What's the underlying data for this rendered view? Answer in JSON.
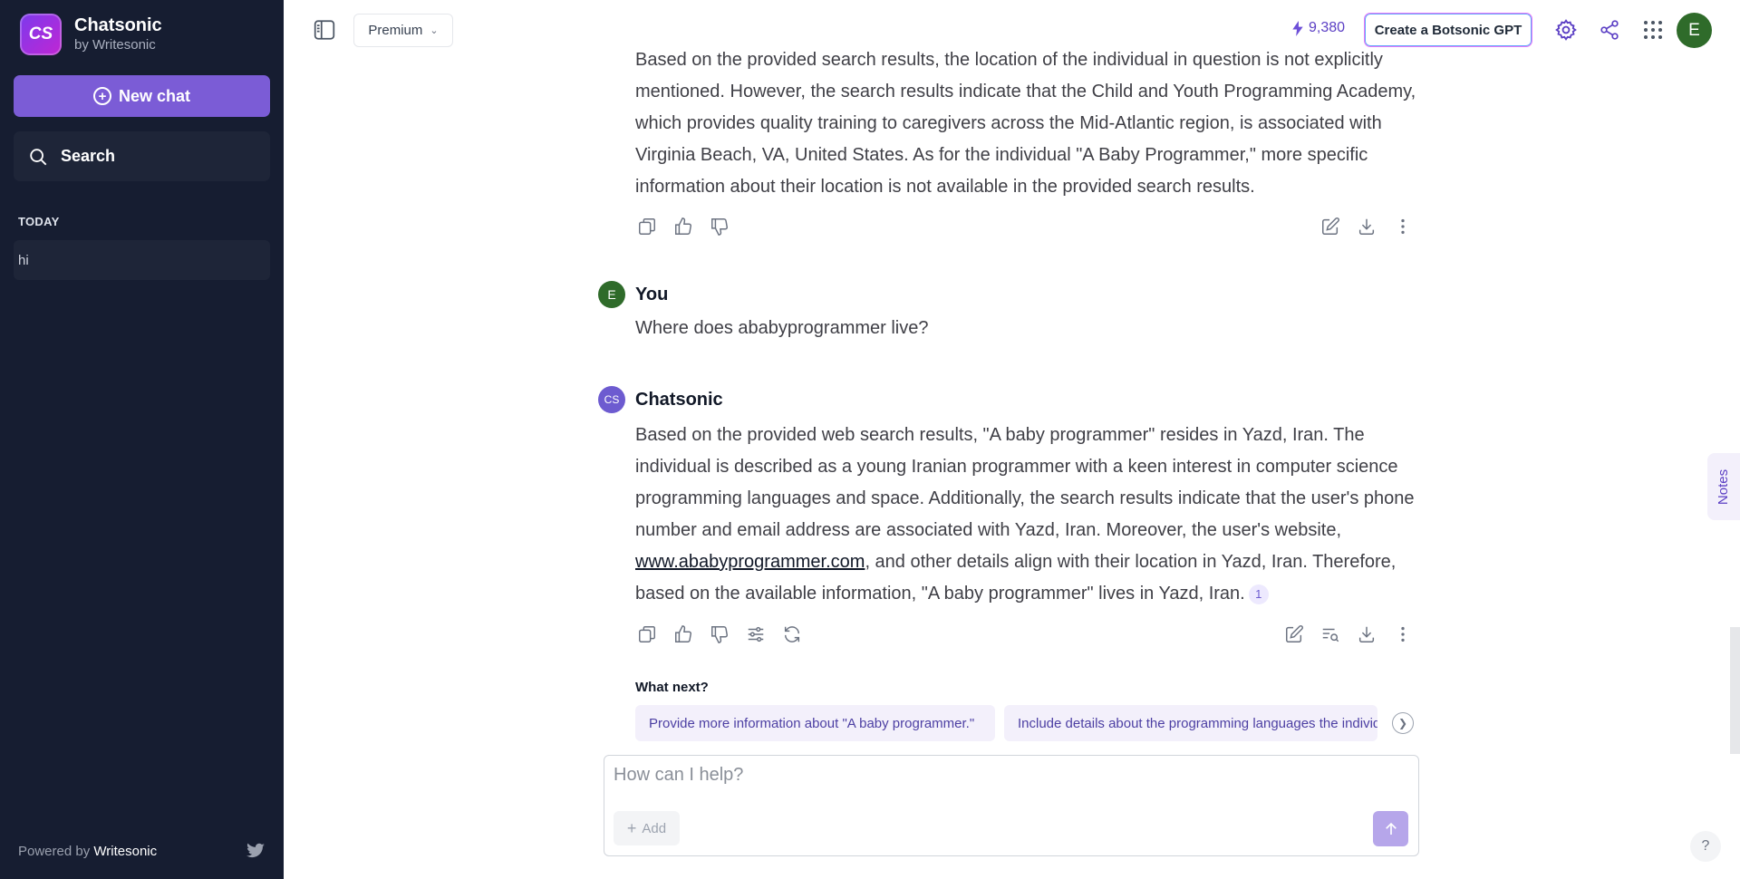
{
  "sidebar": {
    "brand_logo": "CS",
    "brand_name": "Chatsonic",
    "brand_sub": "by Writesonic",
    "new_chat_label": "New chat",
    "search_label": "Search",
    "section_label": "TODAY",
    "chats": [
      {
        "title": "hi"
      }
    ],
    "powered_prefix": "Powered by",
    "powered_brand": "Writesonic"
  },
  "topbar": {
    "plan": "Premium",
    "credits": "9,380",
    "create_gpt_label": "Create a Botsonic GPT",
    "user_initial": "E"
  },
  "conversation": {
    "prev_response": "Based on the provided search results, the location of the individual in question is not explicitly mentioned. However, the search results indicate that the Child and Youth Programming Academy, which provides quality training to caregivers across the Mid-Atlantic region, is associated with Virginia Beach, VA, United States. As for the individual \"A Baby Programmer,\" more specific information about their location is not available in the provided search results.",
    "user_name": "You",
    "user_initial": "E",
    "user_message": "Where does ababyprogrammer live?",
    "bot_name": "Chatsonic",
    "bot_initial": "CS",
    "bot_response_part1": "Based on the provided web search results, \"A baby programmer\" resides in Yazd, Iran. The individual is described as a young Iranian programmer with a keen interest in computer science programming languages and space. Additionally, the search results indicate that the user's phone number and email address are associated with Yazd, Iran. Moreover, the user's website, ",
    "bot_response_link": "www.ababyprogrammer.com",
    "bot_response_part2": ", and other details align with their location in Yazd, Iran. Therefore, based on the available information, \"A baby programmer\" lives in Yazd, Iran.",
    "reference_number": "1"
  },
  "what_next": {
    "title": "What next?",
    "suggestions": [
      "Provide more information about \"A baby programmer.\"",
      "Include details about the programming languages the individual"
    ]
  },
  "composer": {
    "placeholder": "How can I help?",
    "add_label": "Add"
  },
  "notes_label": "Notes",
  "help_label": "?",
  "colors": {
    "sidebar_bg": "#161d31",
    "accent": "#7b5cd6",
    "user_avatar": "#2f6b2a",
    "bot_avatar": "#6d5bd0"
  }
}
